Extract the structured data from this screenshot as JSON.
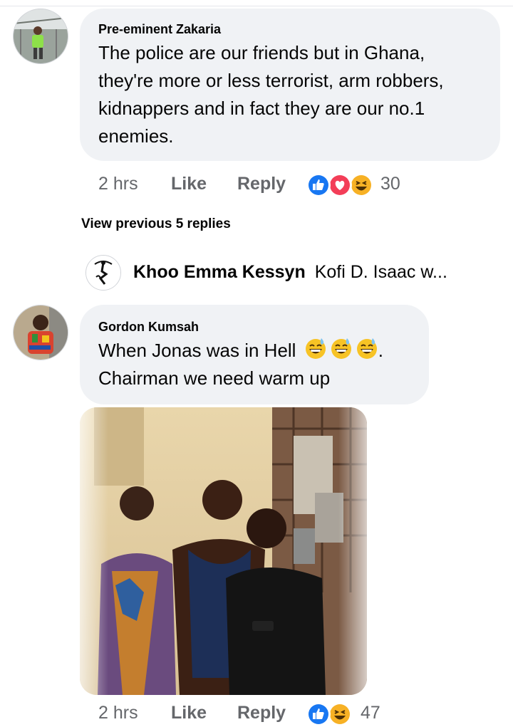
{
  "comments": [
    {
      "author": "Pre-eminent Zakaria",
      "text_lines": [
        "The police are our friends but in Ghana,",
        "they're more or less terrorist, arm robbers,",
        "kidnappers and in fact they are our no.1",
        "enemies."
      ],
      "time": "2 hrs",
      "like_label": "Like",
      "reply_label": "Reply",
      "reaction_count": "30",
      "reactions": [
        "like-icon",
        "love-icon",
        "haha-icon"
      ]
    },
    {
      "author": "Gordon Kumsah",
      "text_line1": "When Jonas was in Hell",
      "text_line1_tail": ".",
      "text_line2": "Chairman we need warm up",
      "emojis": [
        "grinning-sweat-emoji",
        "grinning-sweat-emoji",
        "grinning-sweat-emoji"
      ],
      "time": "2 hrs",
      "like_label": "Like",
      "reply_label": "Reply",
      "reaction_count": "47",
      "reactions": [
        "like-icon",
        "haha-icon"
      ]
    }
  ],
  "view_previous": "View previous 5 replies",
  "reply_preview": {
    "author": "Khoo Emma Kessyn",
    "snippet": "Kofi D. Isaac w..."
  },
  "colors": {
    "bubble": "#f0f2f5",
    "meta_text": "#65676b",
    "like_blue": "#1877f2",
    "love_red": "#f33e58",
    "haha_yellow": "#f7b125"
  }
}
